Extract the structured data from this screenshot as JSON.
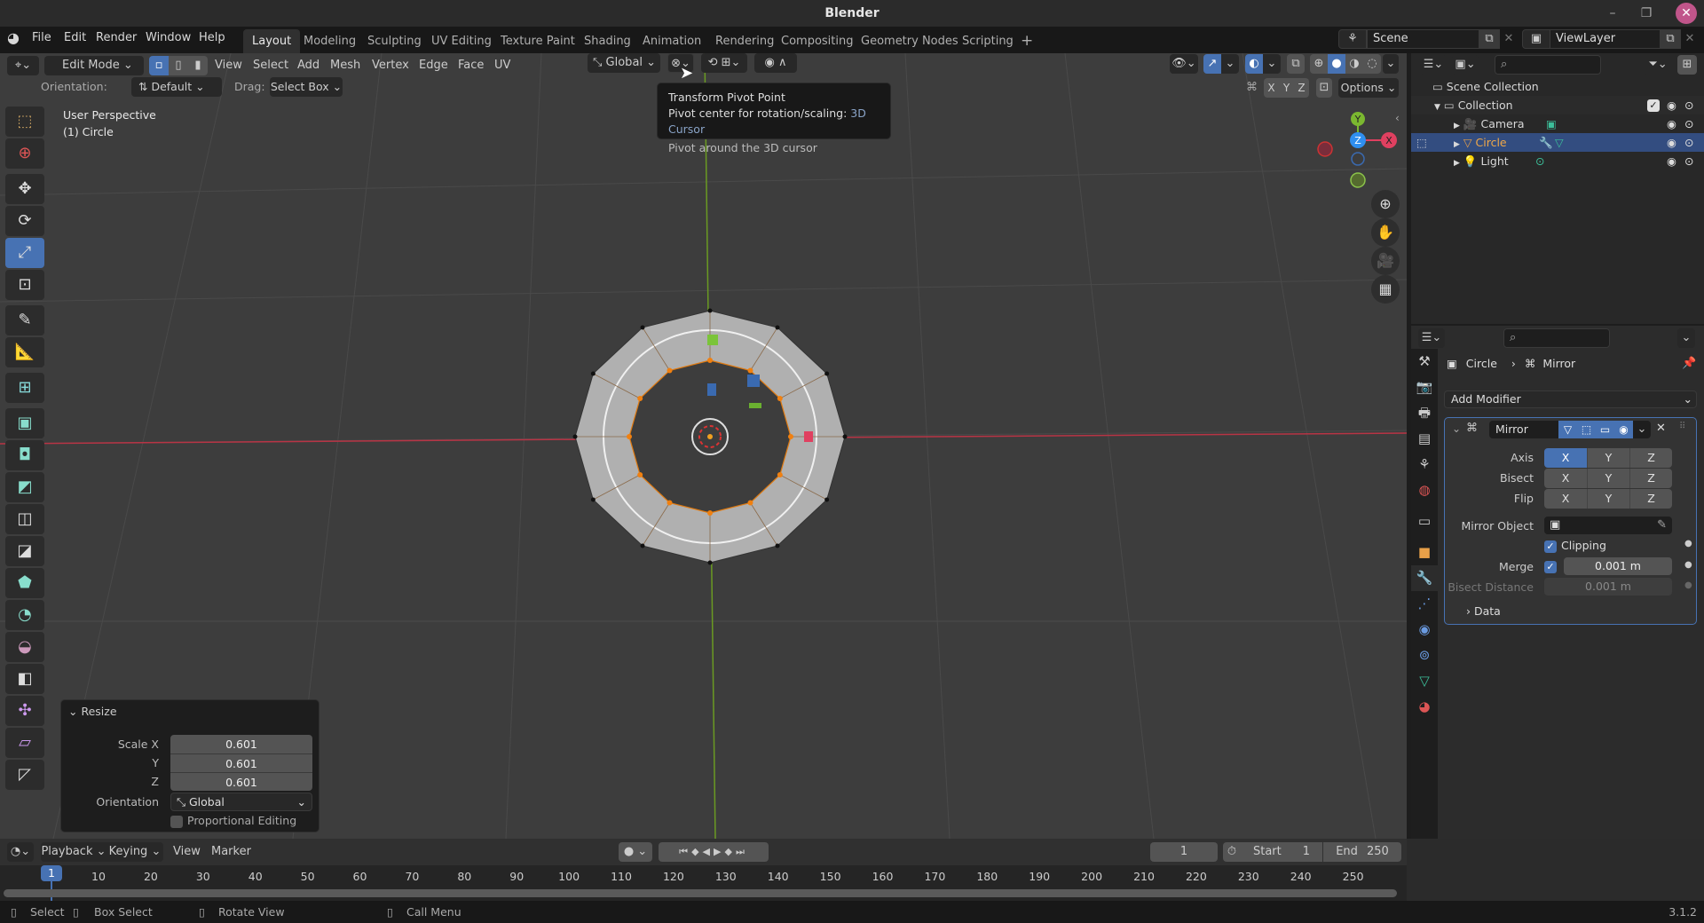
{
  "window": {
    "title": "Blender",
    "version": "3.1.2"
  },
  "menu": [
    "File",
    "Edit",
    "Render",
    "Window",
    "Help"
  ],
  "workspaces": [
    "Layout",
    "Modeling",
    "Sculpting",
    "UV Editing",
    "Texture Paint",
    "Shading",
    "Animation",
    "Rendering",
    "Compositing",
    "Geometry Nodes",
    "Scripting"
  ],
  "active_workspace": "Layout",
  "scene": {
    "name": "Scene",
    "view_layer": "ViewLayer"
  },
  "viewport_header": {
    "mode": "Edit Mode",
    "menus": [
      "View",
      "Select",
      "Add",
      "Mesh",
      "Vertex",
      "Edge",
      "Face",
      "UV"
    ],
    "transform_orientation": "Global",
    "orientation_label": "Orientation:",
    "orientation_value": "Default",
    "drag_label": "Drag:",
    "drag_value": "Select Box",
    "options_label": "Options",
    "axis_x": "X",
    "axis_y": "Y",
    "axis_z": "Z"
  },
  "viewport_info": {
    "perspective": "User Perspective",
    "object": "(1) Circle"
  },
  "tooltip": {
    "title": "Transform Pivot Point",
    "desc_prefix": "Pivot center for rotation/scaling:",
    "desc_value": "3D Cursor",
    "detail": "Pivot around the 3D cursor"
  },
  "gizmo": {
    "y": "Y",
    "z": "Z",
    "x": "X"
  },
  "resize_panel": {
    "title": "Resize",
    "scale_x_label": "Scale X",
    "scale_x": "0.601",
    "y_label": "Y",
    "y": "0.601",
    "z_label": "Z",
    "z": "0.601",
    "orientation_label": "Orientation",
    "orientation": "Global",
    "proportional_label": "Proportional Editing",
    "proportional": false
  },
  "outliner": {
    "scene_collection": "Scene Collection",
    "collection": "Collection",
    "items": [
      {
        "name": "Camera",
        "selected": false
      },
      {
        "name": "Circle",
        "selected": true
      },
      {
        "name": "Light",
        "selected": false
      }
    ]
  },
  "properties": {
    "breadcrumb_object": "Circle",
    "breadcrumb_modifier": "Mirror",
    "add_modifier": "Add Modifier",
    "modifier": {
      "name": "Mirror",
      "axis_label": "Axis",
      "bisect_label": "Bisect",
      "flip_label": "Flip",
      "axis": {
        "X": true,
        "Y": false,
        "Z": false
      },
      "bisect": {
        "X": false,
        "Y": false,
        "Z": false
      },
      "flip": {
        "X": false,
        "Y": false,
        "Z": false
      },
      "mirror_object_label": "Mirror Object",
      "clipping_label": "Clipping",
      "clipping": true,
      "merge_label": "Merge",
      "merge": true,
      "merge_value": "0.001 m",
      "bisect_distance_label": "Bisect Distance",
      "bisect_distance": "0.001 m",
      "data_label": "Data"
    }
  },
  "timeline": {
    "menus": [
      "Playback",
      "Keying",
      "View",
      "Marker"
    ],
    "current_frame": "1",
    "start_label": "Start",
    "start": "1",
    "end_label": "End",
    "end": "250",
    "ticks": [
      "1",
      "10",
      "20",
      "30",
      "40",
      "50",
      "60",
      "70",
      "80",
      "90",
      "100",
      "110",
      "120",
      "130",
      "140",
      "150",
      "160",
      "170",
      "180",
      "190",
      "200",
      "210",
      "220",
      "230",
      "240",
      "250"
    ]
  },
  "statusbar": {
    "select": "Select",
    "box_select": "Box Select",
    "rotate_view": "Rotate View",
    "call_menu": "Call Menu"
  }
}
